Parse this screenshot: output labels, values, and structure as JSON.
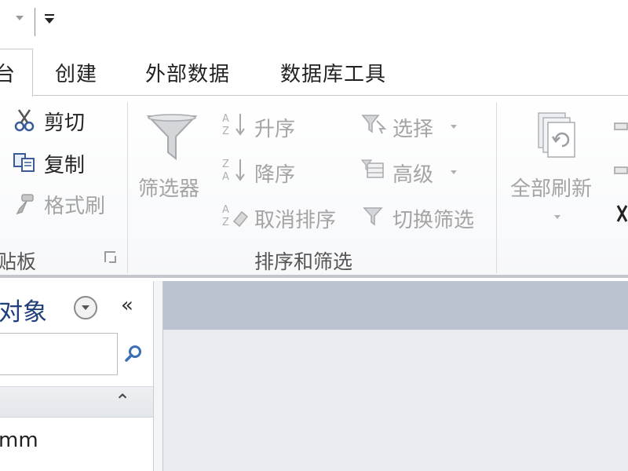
{
  "tabs": {
    "active_label": "台",
    "items": [
      "创建",
      "外部数据",
      "数据库工具"
    ]
  },
  "clipboard": {
    "cut_label": "剪切",
    "copy_label": "复制",
    "format_painter_label": "格式刷",
    "group_label": "贴板"
  },
  "sort_filter": {
    "filter_label": "筛选器",
    "asc_label": "升序",
    "desc_label": "降序",
    "clear_sort_label": "取消排序",
    "selection_label": "选择",
    "advanced_label": "高级",
    "toggle_filter_label": "切换筛选",
    "group_label": "排序和筛选"
  },
  "records": {
    "refresh_all_label": "全部刷新"
  },
  "nav_pane": {
    "title": "对象",
    "collapse_glyph": "«",
    "search_placeholder": "",
    "group_header_glyph": "⌃",
    "item_label": "mm"
  },
  "colors": {
    "accent": "#1f3f7a",
    "work_band": "#bcc3d0",
    "work_bg": "#e9ebf0"
  }
}
